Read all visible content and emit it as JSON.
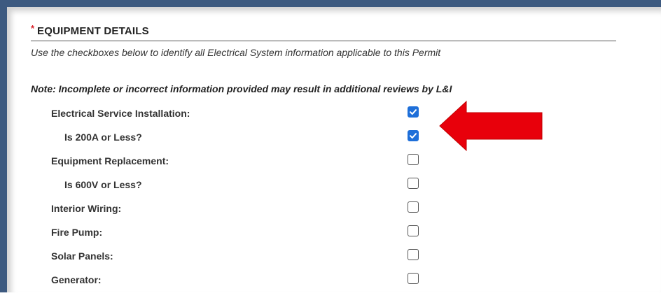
{
  "section": {
    "required_marker": "*",
    "title": "EQUIPMENT DETAILS",
    "instructions": "Use the checkboxes below to identify all Electrical System information applicable to this Permit",
    "note": "Note: Incomplete or incorrect information provided may result in additional reviews by L&I"
  },
  "items": [
    {
      "label": "Electrical Service Installation:",
      "level": 0,
      "checked": true
    },
    {
      "label": "Is 200A or Less?",
      "level": 1,
      "checked": true
    },
    {
      "label": "Equipment Replacement:",
      "level": 0,
      "checked": false
    },
    {
      "label": "Is 600V or Less?",
      "level": 1,
      "checked": false
    },
    {
      "label": "Interior Wiring:",
      "level": 0,
      "checked": false
    },
    {
      "label": "Fire Pump:",
      "level": 0,
      "checked": false
    },
    {
      "label": "Solar Panels:",
      "level": 0,
      "checked": false
    },
    {
      "label": "Generator:",
      "level": 0,
      "checked": false
    }
  ],
  "colors": {
    "frame": "#3d5a80",
    "checkbox_checked": "#1e6fd9",
    "annotation_arrow": "#e8000b",
    "required": "#d9222a"
  },
  "annotation": {
    "icon": "red-left-arrow-icon"
  }
}
